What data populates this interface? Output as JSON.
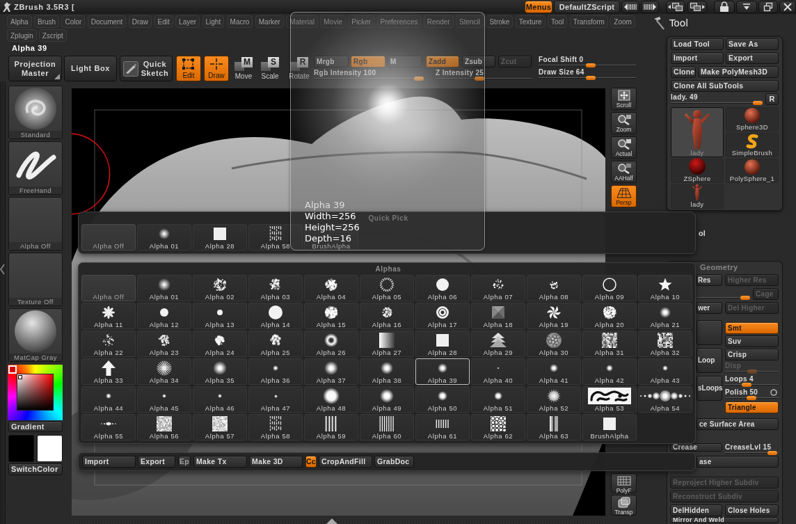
{
  "title_bar": {
    "title": "ZBrush 3.5R3 [",
    "buttons": [
      {
        "label": "Menus",
        "on": true
      },
      {
        "label": "DefaultZScript",
        "on": false
      }
    ]
  },
  "menu_bar": {
    "rows": [
      [
        "Alpha",
        "Brush",
        "Color",
        "Document",
        "Draw",
        "Edit",
        "Layer",
        "Light",
        "Macro",
        "Marker",
        "Material",
        "Movie",
        "Picker",
        "Preferences",
        "Render",
        "Stencil",
        "Stroke",
        "Texture",
        "Tool",
        "Transform",
        "Zoom"
      ],
      [
        "Zplugin",
        "Zscript"
      ]
    ]
  },
  "toolbar": {
    "info": "Alpha 39",
    "shelf_buttons": [
      "Projection Master",
      "Light Box",
      "Quick Sketch"
    ],
    "modes": [
      {
        "kind": "edit",
        "label": "Edit",
        "on": true
      },
      {
        "kind": "draw",
        "label": "Draw",
        "on": true
      },
      {
        "kind": "transform",
        "key": "M",
        "label": "Move",
        "on": false
      },
      {
        "kind": "transform",
        "key": "S",
        "label": "Scale",
        "on": false
      },
      {
        "kind": "transform",
        "key": "R",
        "label": "Rotate",
        "on": false
      }
    ],
    "channels": [
      {
        "label": "Mrgb",
        "on": false,
        "disabled": false
      },
      {
        "label": "Rgb",
        "on": true,
        "disabled": false
      },
      {
        "label": "M",
        "on": false,
        "disabled": false
      },
      {
        "label": "Zadd",
        "on": true,
        "disabled": false
      },
      {
        "label": "Zsub",
        "on": false,
        "disabled": false
      },
      {
        "label": "Zcut",
        "on": false,
        "disabled": true
      }
    ],
    "sliders": [
      {
        "label": "Rgb Intensity",
        "value": "100",
        "level": 1
      },
      {
        "label": "Z Intensity",
        "value": "25",
        "level": 0.45
      },
      {
        "label": "Focal Shift",
        "value": "0",
        "level": 0.54
      },
      {
        "label": "Draw Size",
        "value": "64",
        "level": 0.54
      }
    ]
  },
  "left_shelf": {
    "items": [
      {
        "label": "Standard",
        "kind": "brush"
      },
      {
        "label": "FreeHand",
        "kind": "stroke"
      },
      {
        "label": "Alpha Off",
        "kind": "empty"
      },
      {
        "label": "Texture Off",
        "kind": "empty"
      },
      {
        "label": "MatCap Gray",
        "kind": "material"
      }
    ],
    "gradient_button": "Gradient",
    "swatches": [
      {
        "color": "#000000"
      },
      {
        "color": "#ffffff"
      }
    ],
    "switch_button": "SwitchColor"
  },
  "view_toolbar": {
    "top": [
      {
        "label": "Scroll",
        "on": false
      },
      {
        "label": "Zoom",
        "on": false
      },
      {
        "label": "Actual",
        "on": false
      },
      {
        "label": "AAHalf",
        "on": false
      },
      {
        "label": "Persp",
        "on": true
      }
    ],
    "bottom": [
      {
        "label": "PolyF",
        "on": false
      },
      {
        "label": "Transp",
        "on": false
      }
    ]
  },
  "tool_palette": {
    "title": "Tool",
    "buttons": [
      [
        "Load Tool",
        "Save As"
      ],
      [
        "Import",
        "Export"
      ],
      [
        "Clone",
        "Make PolyMesh3D"
      ],
      [
        "Clone All SubTools"
      ]
    ],
    "subtool_slider": {
      "label": "lady.",
      "value": "49",
      "level": 1
    },
    "reset_button": "R",
    "current_tool": {
      "label": "lady",
      "kind": "mesh",
      "selected": true
    },
    "tools": [
      {
        "label": "Sphere3D",
        "kind": "primitive",
        "selected": false
      },
      {
        "label": "SimpleBrush",
        "kind": "brush",
        "selected": false
      },
      {
        "label": "ZSphere",
        "kind": "zsphere",
        "selected": false
      },
      {
        "label": "PolySphere_1",
        "kind": "primitive",
        "selected": false
      },
      {
        "label": "lady",
        "kind": "mesh",
        "selected": false
      }
    ],
    "subtool_heading": "ol"
  },
  "geometry": {
    "title": "Geometry",
    "rows": [
      {
        "kind": "pair",
        "items": [
          {
            "kind": "button",
            "label": "Res",
            "on": false,
            "disabled": false
          },
          {
            "kind": "button",
            "label": "Higher Res",
            "on": false,
            "disabled": true
          }
        ]
      },
      {
        "kind": "slider_button",
        "items": [
          {
            "kind": "slider",
            "level": 1,
            "disabled": false
          },
          {
            "kind": "button",
            "label": "Cage",
            "on": false,
            "disabled": true
          }
        ]
      },
      {
        "kind": "pair",
        "items": [
          {
            "kind": "button",
            "label": "wer",
            "on": false,
            "disabled": false
          },
          {
            "kind": "button",
            "label": "Del Higher",
            "on": false,
            "disabled": true
          }
        ]
      },
      {
        "kind": "columns",
        "left": [
          {
            "kind": "button",
            "on": false,
            "disabled": false
          },
          {
            "kind": "button",
            "label": "Loop",
            "on": false,
            "disabled": false
          },
          {
            "kind": "button",
            "label": "sLoops",
            "on": false,
            "disabled": false
          }
        ],
        "right": [
          {
            "kind": "button",
            "label": "Smt",
            "on": true,
            "disabled": false
          },
          {
            "kind": "button",
            "label": "Suv",
            "on": false,
            "disabled": false
          },
          {
            "kind": "button",
            "label": "Crisp",
            "on": false,
            "disabled": false
          },
          {
            "kind": "slider",
            "label": "Disp",
            "level": 0.5,
            "disabled": true
          },
          {
            "kind": "slider",
            "label": "Loops",
            "value": "4",
            "level": 0.38,
            "disabled": false
          },
          {
            "kind": "slider",
            "label": "Polish",
            "value": "50",
            "level": 0.49,
            "disabled": false,
            "toggle_on": false
          },
          {
            "kind": "button",
            "label": "Triangle",
            "on": true,
            "disabled": false
          }
        ]
      },
      {
        "kind": "wide",
        "items": [
          {
            "kind": "button",
            "label": "ce Surface Area",
            "on": false,
            "disabled": false
          }
        ]
      },
      {
        "kind": "pair",
        "items": [
          {
            "kind": "button",
            "label": "Crease",
            "on": false,
            "disabled": false
          },
          {
            "kind": "slider",
            "label": "CreaseLvl",
            "value": "15",
            "level": 0.97,
            "disabled": false
          }
        ]
      },
      {
        "kind": "wide",
        "items": [
          {
            "kind": "button",
            "label": "ase",
            "on": false,
            "disabled": false
          }
        ]
      },
      {
        "kind": "wide",
        "items": [
          {
            "kind": "button",
            "label": "Reproject Higher Subdiv",
            "on": false,
            "disabled": true
          }
        ]
      },
      {
        "kind": "wide",
        "items": [
          {
            "kind": "button",
            "label": "Reconstruct Subdiv",
            "on": false,
            "disabled": true
          }
        ]
      },
      {
        "kind": "pair",
        "items": [
          {
            "kind": "button",
            "label": "DelHidden",
            "on": false,
            "disabled": false
          },
          {
            "kind": "button",
            "label": "Close Holes",
            "on": false,
            "disabled": false
          }
        ]
      },
      {
        "kind": "wide",
        "items": [
          {
            "kind": "button",
            "label": "Mirror And Weld",
            "on": false,
            "disabled": false
          }
        ]
      }
    ]
  },
  "alpha_popup": {
    "quick_pick": {
      "title": "Quick Pick",
      "items": [
        {
          "label": "Alpha Off",
          "kind": "empty",
          "selected": false
        },
        {
          "label": "Alpha 01",
          "kind": "alpha",
          "selected": false
        },
        {
          "label": "Alpha 28",
          "kind": "alpha",
          "selected": false
        },
        {
          "label": "Alpha 58",
          "kind": "alpha",
          "selected": false
        },
        {
          "label": "BrushAlpha",
          "kind": "alpha",
          "selected": false
        }
      ]
    },
    "alphas": {
      "title": "Alphas",
      "items": [
        {
          "label": "Alpha Off",
          "kind": "empty",
          "selected": false
        },
        {
          "label": "Alpha 01",
          "kind": "alpha",
          "selected": false
        },
        {
          "label": "Alpha 02",
          "kind": "alpha",
          "selected": false
        },
        {
          "label": "Alpha 03",
          "kind": "alpha",
          "selected": false
        },
        {
          "label": "Alpha 04",
          "kind": "alpha",
          "selected": false
        },
        {
          "label": "Alpha 05",
          "kind": "alpha",
          "selected": false
        },
        {
          "label": "Alpha 06",
          "kind": "alpha",
          "selected": false
        },
        {
          "label": "Alpha 07",
          "kind": "alpha",
          "selected": false
        },
        {
          "label": "Alpha 08",
          "kind": "alpha",
          "selected": false
        },
        {
          "label": "Alpha 09",
          "kind": "alpha",
          "selected": false
        },
        {
          "label": "Alpha 10",
          "kind": "alpha",
          "selected": false
        },
        {
          "label": "Alpha 11",
          "kind": "alpha",
          "selected": false
        },
        {
          "label": "Alpha 12",
          "kind": "alpha",
          "selected": false
        },
        {
          "label": "Alpha 13",
          "kind": "alpha",
          "selected": false
        },
        {
          "label": "Alpha 14",
          "kind": "alpha",
          "selected": false
        },
        {
          "label": "Alpha 15",
          "kind": "alpha",
          "selected": false
        },
        {
          "label": "Alpha 16",
          "kind": "alpha",
          "selected": false
        },
        {
          "label": "Alpha 17",
          "kind": "alpha",
          "selected": false
        },
        {
          "label": "Alpha 18",
          "kind": "alpha",
          "selected": false
        },
        {
          "label": "Alpha 19",
          "kind": "alpha",
          "selected": false
        },
        {
          "label": "Alpha 20",
          "kind": "alpha",
          "selected": false
        },
        {
          "label": "Alpha 21",
          "kind": "alpha",
          "selected": false
        },
        {
          "label": "Alpha 22",
          "kind": "alpha",
          "selected": false
        },
        {
          "label": "Alpha 23",
          "kind": "alpha",
          "selected": false
        },
        {
          "label": "Alpha 24",
          "kind": "alpha",
          "selected": false
        },
        {
          "label": "Alpha 25",
          "kind": "alpha",
          "selected": false
        },
        {
          "label": "Alpha 26",
          "kind": "alpha",
          "selected": false
        },
        {
          "label": "Alpha 27",
          "kind": "alpha",
          "selected": false
        },
        {
          "label": "Alpha 28",
          "kind": "alpha",
          "selected": false
        },
        {
          "label": "Alpha 29",
          "kind": "alpha",
          "selected": false
        },
        {
          "label": "Alpha 30",
          "kind": "alpha",
          "selected": false
        },
        {
          "label": "Alpha 31",
          "kind": "alpha",
          "selected": false
        },
        {
          "label": "Alpha 32",
          "kind": "alpha",
          "selected": false
        },
        {
          "label": "Alpha 33",
          "kind": "alpha",
          "selected": false
        },
        {
          "label": "Alpha 34",
          "kind": "alpha",
          "selected": false
        },
        {
          "label": "Alpha 35",
          "kind": "alpha",
          "selected": false
        },
        {
          "label": "Alpha 36",
          "kind": "alpha",
          "selected": false
        },
        {
          "label": "Alpha 37",
          "kind": "alpha",
          "selected": false
        },
        {
          "label": "Alpha 38",
          "kind": "alpha",
          "selected": false
        },
        {
          "label": "Alpha 39",
          "kind": "alpha",
          "selected": true
        },
        {
          "label": "Alpha 40",
          "kind": "alpha",
          "selected": false
        },
        {
          "label": "Alpha 41",
          "kind": "alpha",
          "selected": false
        },
        {
          "label": "Alpha 42",
          "kind": "alpha",
          "selected": false
        },
        {
          "label": "Alpha 43",
          "kind": "alpha",
          "selected": false
        },
        {
          "label": "Alpha 44",
          "kind": "alpha",
          "selected": false
        },
        {
          "label": "Alpha 45",
          "kind": "alpha",
          "selected": false
        },
        {
          "label": "Alpha 46",
          "kind": "alpha",
          "selected": false
        },
        {
          "label": "Alpha 47",
          "kind": "alpha",
          "selected": false
        },
        {
          "label": "Alpha 48",
          "kind": "alpha",
          "selected": false
        },
        {
          "label": "Alpha 49",
          "kind": "alpha",
          "selected": false
        },
        {
          "label": "Alpha 50",
          "kind": "alpha",
          "selected": false
        },
        {
          "label": "Alpha 51",
          "kind": "alpha",
          "selected": false
        },
        {
          "label": "Alpha 52",
          "kind": "alpha",
          "selected": false
        },
        {
          "label": "Alpha 53",
          "kind": "alpha",
          "selected": false
        },
        {
          "label": "Alpha 54",
          "kind": "alpha",
          "selected": false
        },
        {
          "label": "Alpha 55",
          "kind": "alpha",
          "selected": false
        },
        {
          "label": "Alpha 56",
          "kind": "alpha",
          "selected": false
        },
        {
          "label": "Alpha 57",
          "kind": "alpha",
          "selected": false
        },
        {
          "label": "Alpha 58",
          "kind": "alpha",
          "selected": false
        },
        {
          "label": "Alpha 59",
          "kind": "alpha",
          "selected": false
        },
        {
          "label": "Alpha 60",
          "kind": "alpha",
          "selected": false
        },
        {
          "label": "Alpha 61",
          "kind": "alpha",
          "selected": false
        },
        {
          "label": "Alpha 62",
          "kind": "alpha",
          "selected": false
        },
        {
          "label": "Alpha 63",
          "kind": "alpha",
          "selected": false
        },
        {
          "label": "BrushAlpha",
          "kind": "alpha",
          "selected": false
        }
      ]
    },
    "buttons": [
      {
        "label": "Import",
        "on": false
      },
      {
        "label": "Export",
        "on": false
      },
      {
        "label": "Ep",
        "on": false
      },
      {
        "label": "Make Tx",
        "on": false
      },
      {
        "label": "Make 3D",
        "on": false
      },
      {
        "label": "Cc",
        "on": true
      },
      {
        "label": "CropAndFill",
        "on": false
      },
      {
        "label": "GrabDoc",
        "on": false
      }
    ]
  },
  "tooltip": {
    "lines": [
      "Alpha 39",
      "Width=256",
      "Height=256",
      "Depth=16"
    ]
  }
}
